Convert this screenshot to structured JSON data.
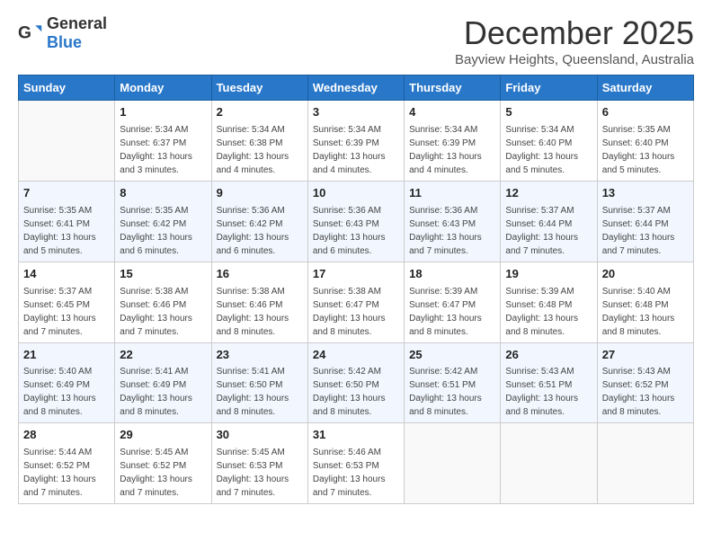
{
  "logo": {
    "general": "General",
    "blue": "Blue"
  },
  "header": {
    "month_title": "December 2025",
    "location": "Bayview Heights, Queensland, Australia"
  },
  "weekdays": [
    "Sunday",
    "Monday",
    "Tuesday",
    "Wednesday",
    "Thursday",
    "Friday",
    "Saturday"
  ],
  "weeks": [
    [
      {
        "day": "",
        "sunrise": "",
        "sunset": "",
        "daylight": ""
      },
      {
        "day": "1",
        "sunrise": "Sunrise: 5:34 AM",
        "sunset": "Sunset: 6:37 PM",
        "daylight": "Daylight: 13 hours and 3 minutes."
      },
      {
        "day": "2",
        "sunrise": "Sunrise: 5:34 AM",
        "sunset": "Sunset: 6:38 PM",
        "daylight": "Daylight: 13 hours and 4 minutes."
      },
      {
        "day": "3",
        "sunrise": "Sunrise: 5:34 AM",
        "sunset": "Sunset: 6:39 PM",
        "daylight": "Daylight: 13 hours and 4 minutes."
      },
      {
        "day": "4",
        "sunrise": "Sunrise: 5:34 AM",
        "sunset": "Sunset: 6:39 PM",
        "daylight": "Daylight: 13 hours and 4 minutes."
      },
      {
        "day": "5",
        "sunrise": "Sunrise: 5:34 AM",
        "sunset": "Sunset: 6:40 PM",
        "daylight": "Daylight: 13 hours and 5 minutes."
      },
      {
        "day": "6",
        "sunrise": "Sunrise: 5:35 AM",
        "sunset": "Sunset: 6:40 PM",
        "daylight": "Daylight: 13 hours and 5 minutes."
      }
    ],
    [
      {
        "day": "7",
        "sunrise": "Sunrise: 5:35 AM",
        "sunset": "Sunset: 6:41 PM",
        "daylight": "Daylight: 13 hours and 5 minutes."
      },
      {
        "day": "8",
        "sunrise": "Sunrise: 5:35 AM",
        "sunset": "Sunset: 6:42 PM",
        "daylight": "Daylight: 13 hours and 6 minutes."
      },
      {
        "day": "9",
        "sunrise": "Sunrise: 5:36 AM",
        "sunset": "Sunset: 6:42 PM",
        "daylight": "Daylight: 13 hours and 6 minutes."
      },
      {
        "day": "10",
        "sunrise": "Sunrise: 5:36 AM",
        "sunset": "Sunset: 6:43 PM",
        "daylight": "Daylight: 13 hours and 6 minutes."
      },
      {
        "day": "11",
        "sunrise": "Sunrise: 5:36 AM",
        "sunset": "Sunset: 6:43 PM",
        "daylight": "Daylight: 13 hours and 7 minutes."
      },
      {
        "day": "12",
        "sunrise": "Sunrise: 5:37 AM",
        "sunset": "Sunset: 6:44 PM",
        "daylight": "Daylight: 13 hours and 7 minutes."
      },
      {
        "day": "13",
        "sunrise": "Sunrise: 5:37 AM",
        "sunset": "Sunset: 6:44 PM",
        "daylight": "Daylight: 13 hours and 7 minutes."
      }
    ],
    [
      {
        "day": "14",
        "sunrise": "Sunrise: 5:37 AM",
        "sunset": "Sunset: 6:45 PM",
        "daylight": "Daylight: 13 hours and 7 minutes."
      },
      {
        "day": "15",
        "sunrise": "Sunrise: 5:38 AM",
        "sunset": "Sunset: 6:46 PM",
        "daylight": "Daylight: 13 hours and 7 minutes."
      },
      {
        "day": "16",
        "sunrise": "Sunrise: 5:38 AM",
        "sunset": "Sunset: 6:46 PM",
        "daylight": "Daylight: 13 hours and 8 minutes."
      },
      {
        "day": "17",
        "sunrise": "Sunrise: 5:38 AM",
        "sunset": "Sunset: 6:47 PM",
        "daylight": "Daylight: 13 hours and 8 minutes."
      },
      {
        "day": "18",
        "sunrise": "Sunrise: 5:39 AM",
        "sunset": "Sunset: 6:47 PM",
        "daylight": "Daylight: 13 hours and 8 minutes."
      },
      {
        "day": "19",
        "sunrise": "Sunrise: 5:39 AM",
        "sunset": "Sunset: 6:48 PM",
        "daylight": "Daylight: 13 hours and 8 minutes."
      },
      {
        "day": "20",
        "sunrise": "Sunrise: 5:40 AM",
        "sunset": "Sunset: 6:48 PM",
        "daylight": "Daylight: 13 hours and 8 minutes."
      }
    ],
    [
      {
        "day": "21",
        "sunrise": "Sunrise: 5:40 AM",
        "sunset": "Sunset: 6:49 PM",
        "daylight": "Daylight: 13 hours and 8 minutes."
      },
      {
        "day": "22",
        "sunrise": "Sunrise: 5:41 AM",
        "sunset": "Sunset: 6:49 PM",
        "daylight": "Daylight: 13 hours and 8 minutes."
      },
      {
        "day": "23",
        "sunrise": "Sunrise: 5:41 AM",
        "sunset": "Sunset: 6:50 PM",
        "daylight": "Daylight: 13 hours and 8 minutes."
      },
      {
        "day": "24",
        "sunrise": "Sunrise: 5:42 AM",
        "sunset": "Sunset: 6:50 PM",
        "daylight": "Daylight: 13 hours and 8 minutes."
      },
      {
        "day": "25",
        "sunrise": "Sunrise: 5:42 AM",
        "sunset": "Sunset: 6:51 PM",
        "daylight": "Daylight: 13 hours and 8 minutes."
      },
      {
        "day": "26",
        "sunrise": "Sunrise: 5:43 AM",
        "sunset": "Sunset: 6:51 PM",
        "daylight": "Daylight: 13 hours and 8 minutes."
      },
      {
        "day": "27",
        "sunrise": "Sunrise: 5:43 AM",
        "sunset": "Sunset: 6:52 PM",
        "daylight": "Daylight: 13 hours and 8 minutes."
      }
    ],
    [
      {
        "day": "28",
        "sunrise": "Sunrise: 5:44 AM",
        "sunset": "Sunset: 6:52 PM",
        "daylight": "Daylight: 13 hours and 7 minutes."
      },
      {
        "day": "29",
        "sunrise": "Sunrise: 5:45 AM",
        "sunset": "Sunset: 6:52 PM",
        "daylight": "Daylight: 13 hours and 7 minutes."
      },
      {
        "day": "30",
        "sunrise": "Sunrise: 5:45 AM",
        "sunset": "Sunset: 6:53 PM",
        "daylight": "Daylight: 13 hours and 7 minutes."
      },
      {
        "day": "31",
        "sunrise": "Sunrise: 5:46 AM",
        "sunset": "Sunset: 6:53 PM",
        "daylight": "Daylight: 13 hours and 7 minutes."
      },
      {
        "day": "",
        "sunrise": "",
        "sunset": "",
        "daylight": ""
      },
      {
        "day": "",
        "sunrise": "",
        "sunset": "",
        "daylight": ""
      },
      {
        "day": "",
        "sunrise": "",
        "sunset": "",
        "daylight": ""
      }
    ]
  ]
}
